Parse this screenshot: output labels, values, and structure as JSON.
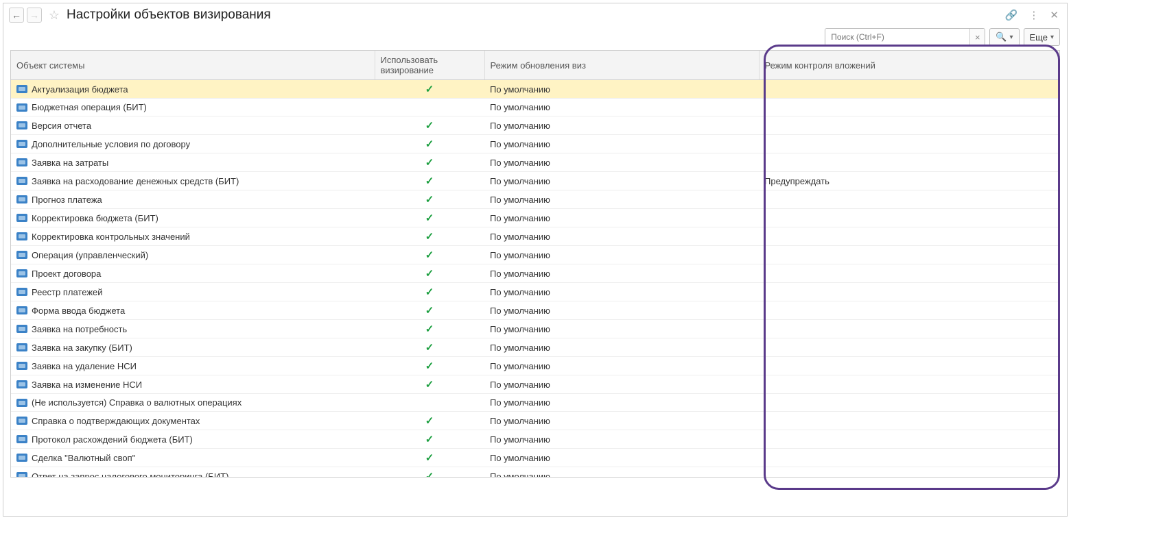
{
  "header": {
    "title": "Настройки объектов визирования"
  },
  "toolbar": {
    "search_placeholder": "Поиск (Ctrl+F)",
    "more_label": "Еще"
  },
  "table": {
    "headers": {
      "object": "Объект системы",
      "use": "Использовать визирование",
      "mode": "Режим обновления виз",
      "control": "Режим контроля вложений"
    },
    "rows": [
      {
        "object": "Актуализация бюджета",
        "use": true,
        "mode": "По умолчанию",
        "control": "",
        "selected": true
      },
      {
        "object": "Бюджетная операция (БИТ)",
        "use": false,
        "mode": "По умолчанию",
        "control": ""
      },
      {
        "object": "Версия отчета",
        "use": true,
        "mode": "По умолчанию",
        "control": ""
      },
      {
        "object": "Дополнительные условия по договору",
        "use": true,
        "mode": "По умолчанию",
        "control": ""
      },
      {
        "object": "Заявка на затраты",
        "use": true,
        "mode": "По умолчанию",
        "control": ""
      },
      {
        "object": "Заявка на расходование денежных средств (БИТ)",
        "use": true,
        "mode": "По умолчанию",
        "control": "Предупреждать"
      },
      {
        "object": "Прогноз платежа",
        "use": true,
        "mode": "По умолчанию",
        "control": ""
      },
      {
        "object": "Корректировка бюджета (БИТ)",
        "use": true,
        "mode": "По умолчанию",
        "control": ""
      },
      {
        "object": "Корректировка контрольных значений",
        "use": true,
        "mode": "По умолчанию",
        "control": ""
      },
      {
        "object": "Операция (управленческий)",
        "use": true,
        "mode": "По умолчанию",
        "control": ""
      },
      {
        "object": "Проект договора",
        "use": true,
        "mode": "По умолчанию",
        "control": ""
      },
      {
        "object": "Реестр платежей",
        "use": true,
        "mode": "По умолчанию",
        "control": ""
      },
      {
        "object": "Форма ввода бюджета",
        "use": true,
        "mode": "По умолчанию",
        "control": ""
      },
      {
        "object": "Заявка на потребность",
        "use": true,
        "mode": "По умолчанию",
        "control": ""
      },
      {
        "object": "Заявка на закупку (БИТ)",
        "use": true,
        "mode": "По умолчанию",
        "control": ""
      },
      {
        "object": "Заявка на удаление НСИ",
        "use": true,
        "mode": "По умолчанию",
        "control": ""
      },
      {
        "object": "Заявка на изменение НСИ",
        "use": true,
        "mode": "По умолчанию",
        "control": ""
      },
      {
        "object": "(Не используется) Справка о валютных операциях",
        "use": false,
        "mode": "По умолчанию",
        "control": ""
      },
      {
        "object": "Справка о подтверждающих документах",
        "use": true,
        "mode": "По умолчанию",
        "control": ""
      },
      {
        "object": "Протокол расхождений бюджета (БИТ)",
        "use": true,
        "mode": "По умолчанию",
        "control": ""
      },
      {
        "object": "Сделка \"Валютный своп\"",
        "use": true,
        "mode": "По умолчанию",
        "control": ""
      },
      {
        "object": "Ответ на запрос налогового мониторинга (БИТ)",
        "use": true,
        "mode": "По умолчанию",
        "control": ""
      }
    ]
  }
}
